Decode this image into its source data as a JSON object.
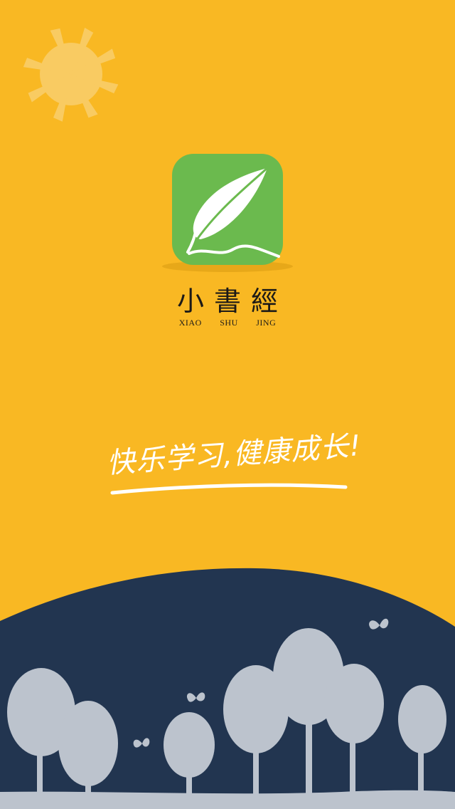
{
  "splash": {
    "app_name": "小書經",
    "app_name_romanized": "XIAO SHU JING",
    "slogan": "快乐学习,健康成长!"
  },
  "colors": {
    "background": "#F9B823",
    "sun": "#F9CB62",
    "icon_bg": "#6BBA4E",
    "hill": "#223550",
    "tree": "#BCC3CD",
    "text": "#1D1A17"
  },
  "icons": {
    "sun": "sun-icon",
    "logo": "feather-icon",
    "butterfly": "butterfly-icon",
    "tree": "tree-icon"
  }
}
